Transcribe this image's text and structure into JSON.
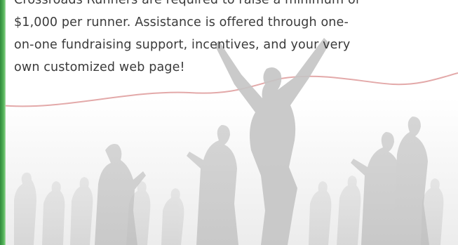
{
  "paragraph": {
    "lines": [
      "Crossroads Runners are required to raise a minimum of",
      "$1,000 per runner. Assistance is offered  through one-",
      "on-one  fundraising support, incentives, and your very",
      "own customized web page!"
    ]
  },
  "colors": {
    "accent_bar": "#3f9e48",
    "text": "#3a3a3a",
    "finish_line": "#e3a9a9",
    "silhouette": "#cfcfcf"
  }
}
